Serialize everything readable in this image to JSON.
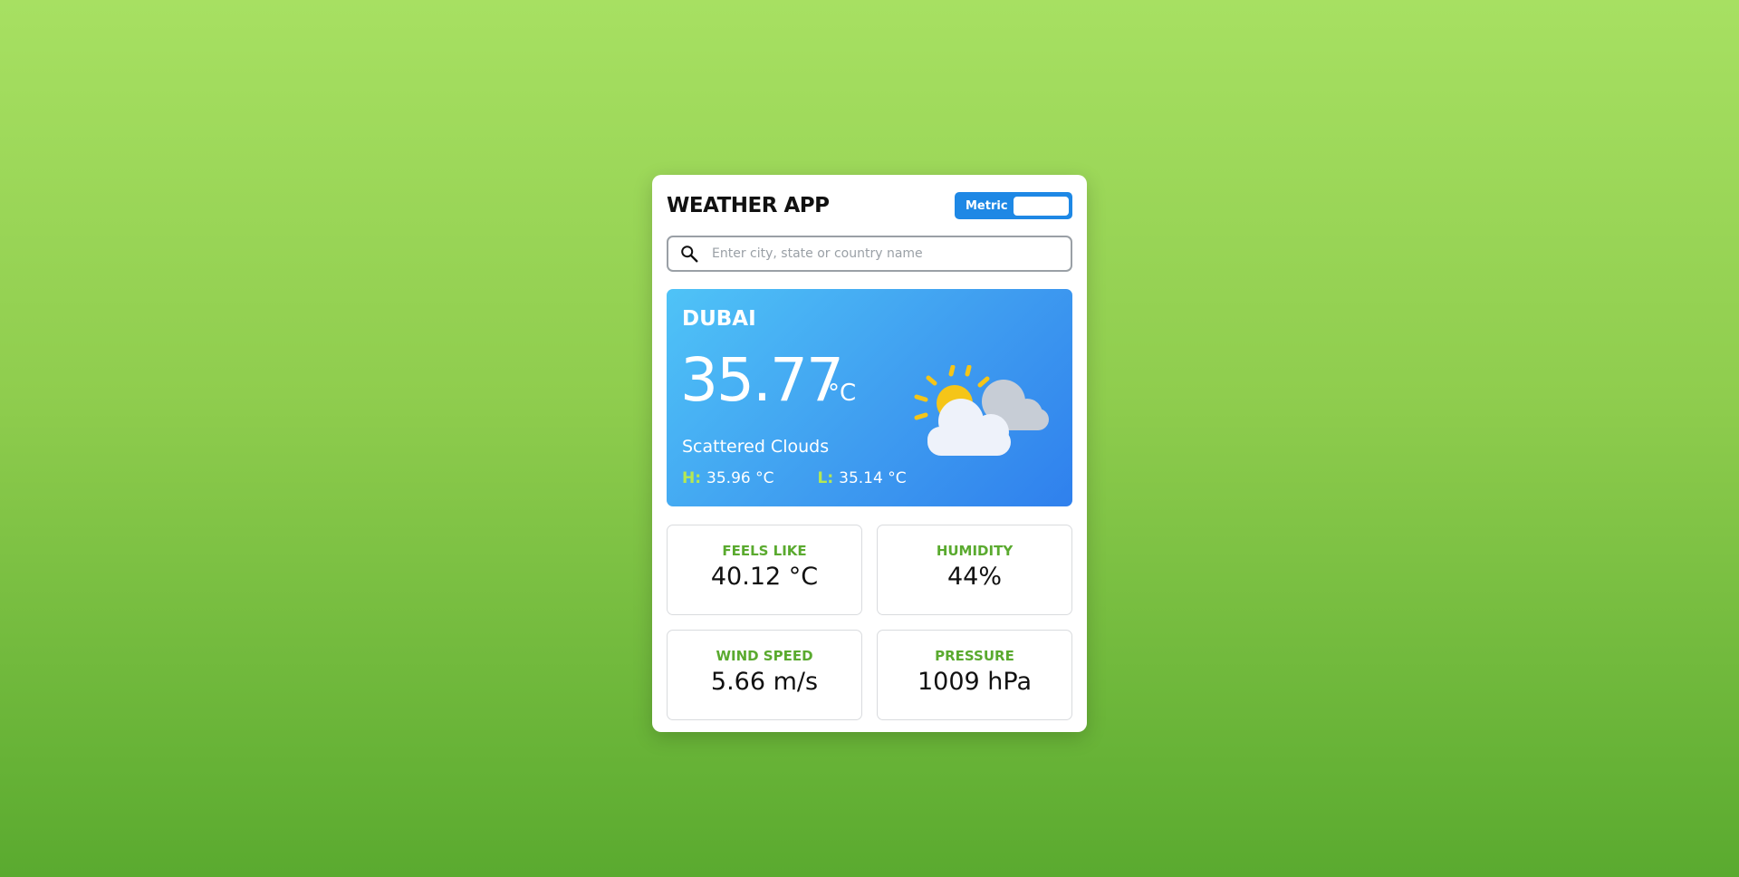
{
  "header": {
    "title": "WEATHER APP",
    "unit_toggle_label": "Metric"
  },
  "search": {
    "placeholder": "Enter city, state or country name",
    "value": ""
  },
  "current": {
    "city": "DUBAI",
    "temperature": "35.77",
    "temperature_unit": "°C",
    "condition": "Scattered Clouds",
    "high_label": "H:",
    "high_value": "35.96 °C",
    "low_label": "L:",
    "low_value": "35.14 °C",
    "icon": "sun-behind-clouds-icon"
  },
  "stats": [
    {
      "label": "FEELS LIKE",
      "value": "40.12 °C"
    },
    {
      "label": "HUMIDITY",
      "value": "44%"
    },
    {
      "label": "WIND SPEED",
      "value": "5.66 m/s"
    },
    {
      "label": "PRESSURE",
      "value": "1009 hPa"
    }
  ],
  "colors": {
    "accent_blue": "#1e88e5",
    "accent_green": "#5aaa2f",
    "hilo_key": "#b5e853"
  }
}
